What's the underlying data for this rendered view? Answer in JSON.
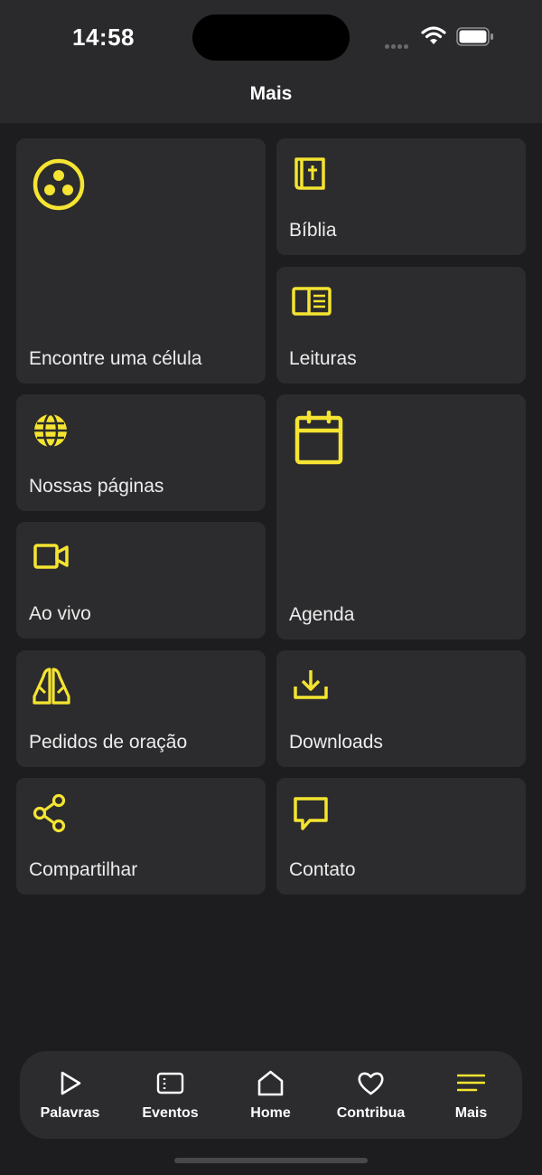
{
  "status_bar": {
    "time": "14:58"
  },
  "header": {
    "title": "Mais"
  },
  "tiles": {
    "celula": {
      "label": "Encontre uma célula",
      "icon": "group-circle-icon"
    },
    "biblia": {
      "label": "Bíblia",
      "icon": "bible-icon"
    },
    "leituras": {
      "label": "Leituras",
      "icon": "book-reading-icon"
    },
    "paginas": {
      "label": "Nossas páginas",
      "icon": "globe-icon"
    },
    "agenda": {
      "label": "Agenda",
      "icon": "calendar-icon"
    },
    "ao_vivo": {
      "label": "Ao vivo",
      "icon": "video-camera-icon"
    },
    "oracao": {
      "label": "Pedidos de oração",
      "icon": "praying-hands-icon"
    },
    "downloads": {
      "label": "Downloads",
      "icon": "download-icon"
    },
    "compartilhar": {
      "label": "Compartilhar",
      "icon": "share-icon"
    },
    "contato": {
      "label": "Contato",
      "icon": "chat-bubble-icon"
    }
  },
  "tabbar": {
    "items": [
      {
        "label": "Palavras",
        "icon": "play-icon"
      },
      {
        "label": "Eventos",
        "icon": "ticket-icon"
      },
      {
        "label": "Home",
        "icon": "home-icon"
      },
      {
        "label": "Contribua",
        "icon": "heart-icon"
      },
      {
        "label": "Mais",
        "icon": "menu-icon",
        "active": true
      }
    ]
  },
  "colors": {
    "accent": "#f5e431",
    "background": "#1d1d1f",
    "tile": "#2c2c2e",
    "header": "#2a2a2c"
  }
}
